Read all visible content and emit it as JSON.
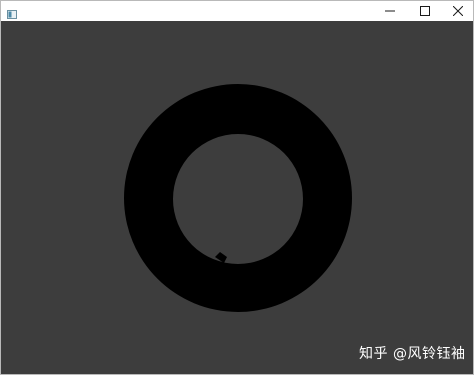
{
  "window": {
    "title": "",
    "controls": {
      "minimize_icon": "minimize-icon",
      "maximize_icon": "maximize-icon",
      "close_icon": "close-icon"
    }
  },
  "canvas": {
    "background_color": "#3d3d3d",
    "ring_color": "#000000"
  },
  "watermark": {
    "text": "知乎 @风铃钰袖"
  }
}
